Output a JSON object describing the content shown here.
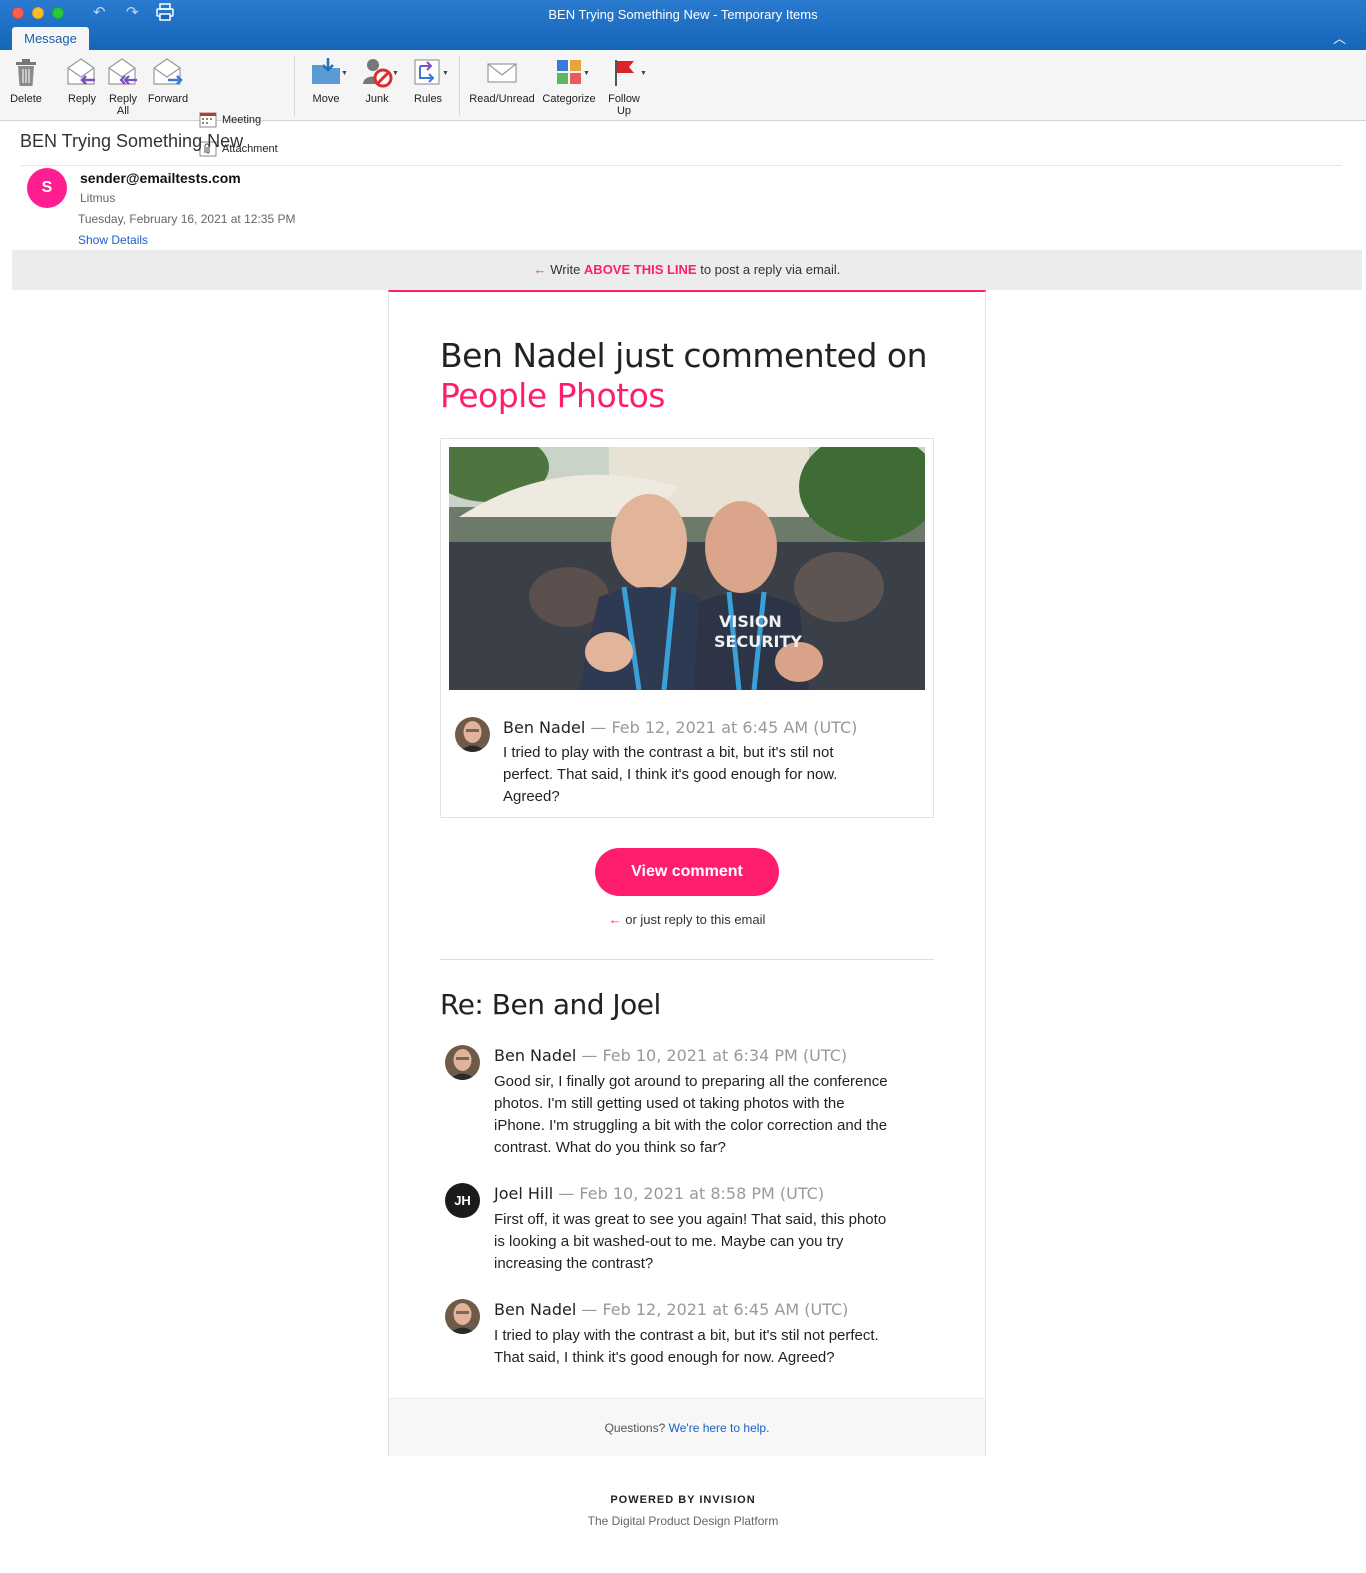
{
  "window": {
    "title": "BEN Trying Something New - Temporary Items",
    "tab": "Message"
  },
  "ribbon": {
    "delete": "Delete",
    "reply": "Reply",
    "reply_all_1": "Reply",
    "reply_all_2": "All",
    "forward": "Forward",
    "meeting": "Meeting",
    "attachment": "Attachment",
    "move": "Move",
    "junk": "Junk",
    "rules": "Rules",
    "read_unread": "Read/Unread",
    "categorize": "Categorize",
    "follow_up_1": "Follow",
    "follow_up_2": "Up"
  },
  "message": {
    "subject": "BEN Trying Something New",
    "avatar_letter": "S",
    "from_address": "sender@emailtests.com",
    "from_name": "Litmus",
    "date": "Tuesday, February 16, 2021 at 12:35 PM",
    "show_details": "Show Details"
  },
  "banner": {
    "arrow": "←",
    "prefix": " Write ",
    "highlight": "ABOVE THIS LINE",
    "suffix": " to post a reply via email."
  },
  "email": {
    "headline": "Ben Nadel just commented on",
    "headline_link": "People Photos",
    "featured_comment": {
      "author": "Ben Nadel",
      "meta": " — Feb 12, 2021 at 6:45 AM (UTC)",
      "lines": [
        "I tried to play with the contrast a bit, but it's stil not",
        "perfect. That said, I think it's good enough for now.",
        "Agreed?"
      ]
    },
    "view_button": "View comment",
    "reply_arrow": "←",
    "reply_note": " or just reply to this email",
    "thread_title": "Re: Ben and Joel",
    "thread": [
      {
        "author": "Ben Nadel",
        "meta": " — Feb 10, 2021 at 6:34 PM (UTC)",
        "lines": [
          "Good sir, I finally got around to preparing all the conference",
          "photos. I'm still getting used ot taking photos with the",
          "iPhone. I'm struggling a bit with the color correction and the",
          "contrast. What do you think so far?"
        ]
      },
      {
        "author": "Joel Hill",
        "initials": "JH",
        "meta": " — Feb 10, 2021 at 8:58 PM (UTC)",
        "lines": [
          "First off, it was great to see you again! That said, this photo",
          "is looking a bit washed-out to me. Maybe can you try",
          "increasing the contrast?"
        ]
      },
      {
        "author": "Ben Nadel",
        "meta": " — Feb 12, 2021 at 6:45 AM (UTC)",
        "lines": [
          "I tried to play with the contrast a bit, but it's stil not perfect.",
          "That said, I think it's good enough for now. Agreed?"
        ]
      }
    ],
    "footer_prefix": "Questions? ",
    "footer_link": "We're here to help."
  },
  "powered_by": "POWERED BY INVISION",
  "tagline": "The Digital Product Design Platform",
  "colors": {
    "accent": "#ff1e6d",
    "titlebar": "#1565b8",
    "link": "#1a5fc7"
  }
}
